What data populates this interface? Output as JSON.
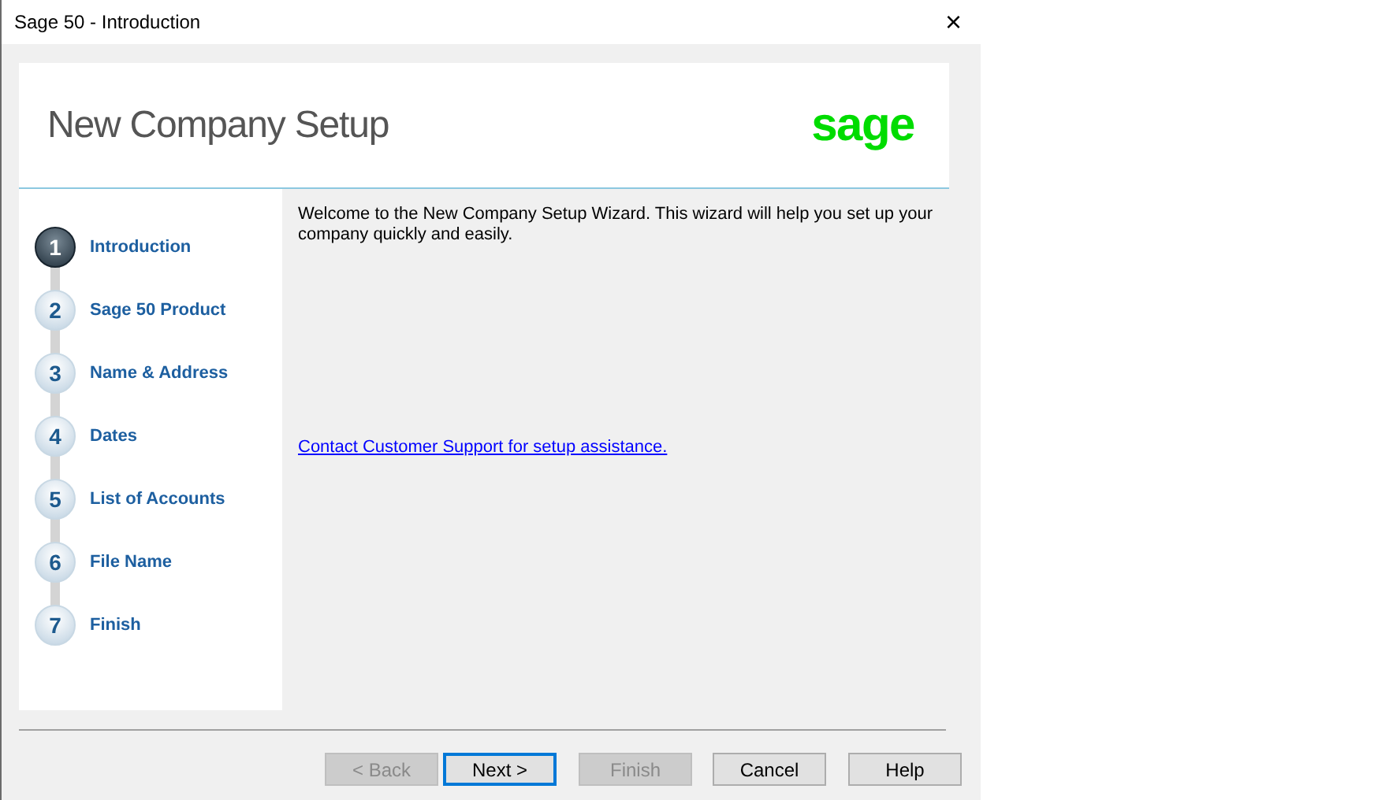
{
  "window": {
    "title": "Sage 50 - Introduction",
    "close": "×"
  },
  "header": {
    "title": "New Company Setup",
    "logo": "sage"
  },
  "steps": [
    {
      "number": "1",
      "label": "Introduction",
      "selected": true
    },
    {
      "number": "2",
      "label": "Sage 50 Product",
      "selected": false
    },
    {
      "number": "3",
      "label": "Name & Address",
      "selected": false
    },
    {
      "number": "4",
      "label": "Dates",
      "selected": false
    },
    {
      "number": "5",
      "label": "List of Accounts",
      "selected": false
    },
    {
      "number": "6",
      "label": "File Name",
      "selected": false
    },
    {
      "number": "7",
      "label": "Finish",
      "selected": false
    }
  ],
  "content": {
    "text": "Welcome to the New Company Setup Wizard. This wizard will help you set up your company quickly and easily.",
    "link": "Contact Customer Support for setup assistance."
  },
  "buttons": [
    {
      "label": "< Back",
      "disabled": true,
      "focused": false
    },
    {
      "label": "Next >",
      "disabled": false,
      "focused": true
    },
    {
      "label": "Finish",
      "disabled": true,
      "focused": false
    },
    {
      "label": "Cancel",
      "disabled": false,
      "focused": false
    },
    {
      "label": "Help",
      "disabled": false,
      "focused": false
    }
  ]
}
